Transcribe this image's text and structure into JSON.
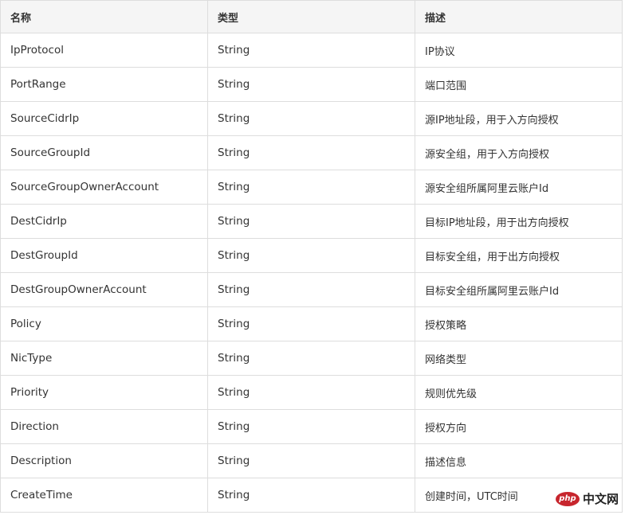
{
  "table": {
    "headers": [
      "名称",
      "类型",
      "描述"
    ],
    "rows": [
      [
        "IpProtocol",
        "String",
        "IP协议"
      ],
      [
        "PortRange",
        "String",
        "端口范围"
      ],
      [
        "SourceCidrIp",
        "String",
        "源IP地址段，用于入方向授权"
      ],
      [
        "SourceGroupId",
        "String",
        "源安全组，用于入方向授权"
      ],
      [
        "SourceGroupOwnerAccount",
        "String",
        "源安全组所属阿里云账户Id"
      ],
      [
        "DestCidrIp",
        "String",
        "目标IP地址段，用于出方向授权"
      ],
      [
        "DestGroupId",
        "String",
        "目标安全组，用于出方向授权"
      ],
      [
        "DestGroupOwnerAccount",
        "String",
        "目标安全组所属阿里云账户Id"
      ],
      [
        "Policy",
        "String",
        "授权策略"
      ],
      [
        "NicType",
        "String",
        "网络类型"
      ],
      [
        "Priority",
        "String",
        "规则优先级"
      ],
      [
        "Direction",
        "String",
        "授权方向"
      ],
      [
        "Description",
        "String",
        "描述信息"
      ],
      [
        "CreateTime",
        "String",
        "创建时间，UTC时间"
      ]
    ]
  },
  "watermark": {
    "badge": "php",
    "site": "中文网"
  }
}
